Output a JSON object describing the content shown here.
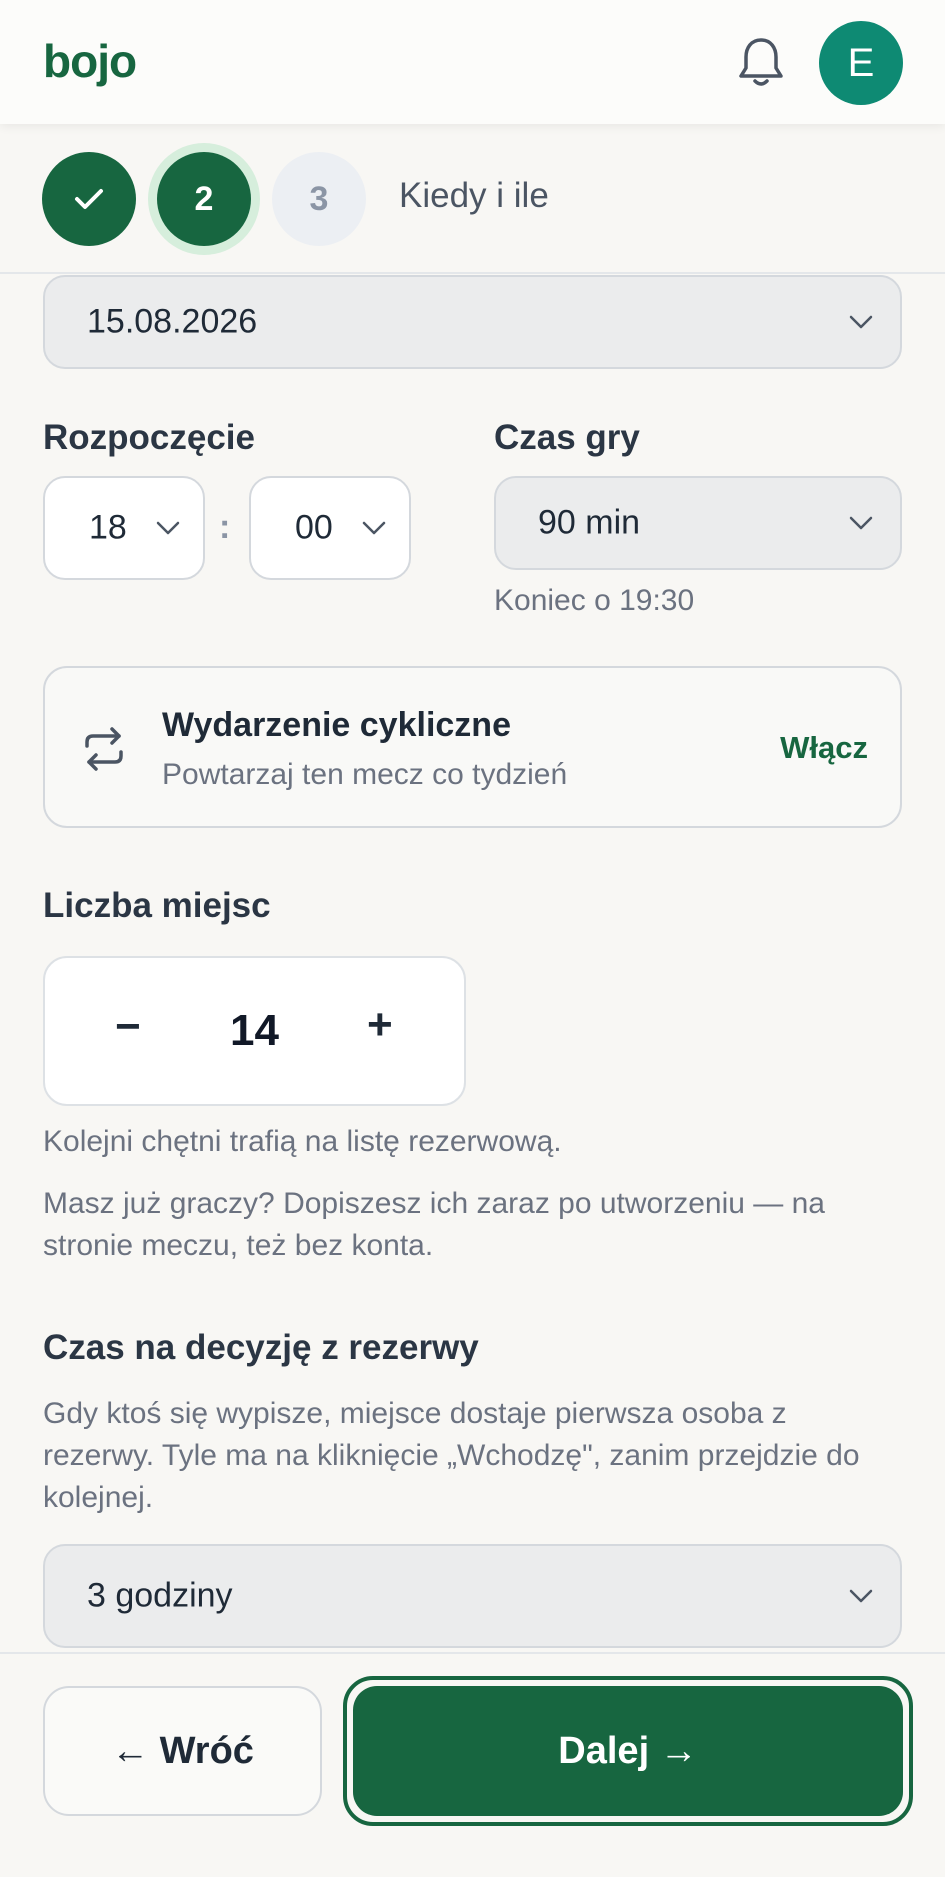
{
  "header": {
    "logo": "bojo",
    "notification_icon": "bell-icon",
    "avatar_initial": "E"
  },
  "stepper": {
    "steps": [
      {
        "label": "✓",
        "state": "done"
      },
      {
        "label": "2",
        "state": "current"
      },
      {
        "label": "3",
        "state": "todo"
      }
    ],
    "title": "Kiedy i ile"
  },
  "date": {
    "value": "15.08.2026"
  },
  "start": {
    "label": "Rozpoczęcie",
    "hour": "18",
    "separator": ":",
    "minute": "00"
  },
  "duration": {
    "label": "Czas gry",
    "value": "90 min",
    "end_text": "Koniec o 19:30"
  },
  "recurring": {
    "icon": "repeat-icon",
    "title": "Wydarzenie cykliczne",
    "subtitle": "Powtarzaj ten mecz co tydzień",
    "toggle_label": "Włącz"
  },
  "seats": {
    "label": "Liczba miejsc",
    "minus": "−",
    "value": "14",
    "plus": "+",
    "hint1": "Kolejni chętni trafią na listę rezerwową.",
    "hint2": "Masz już graczy? Dopiszesz ich zaraz po utworzeniu — na stronie meczu, też bez konta."
  },
  "reserve": {
    "label": "Czas na decyzję z rezerwy",
    "description": "Gdy ktoś się wypisze, miejsce dostaje pierwsza osoba z rezerwy. Tyle ma na kliknięcie „Wchodzę\", zanim przejdzie do kolejnej.",
    "value": "3 godziny"
  },
  "footer": {
    "back_label": "← Wróć",
    "next_label": "Dalej →"
  },
  "colors": {
    "brand": "#176640",
    "avatar": "#0e8a73",
    "background": "#f8f7f4"
  }
}
